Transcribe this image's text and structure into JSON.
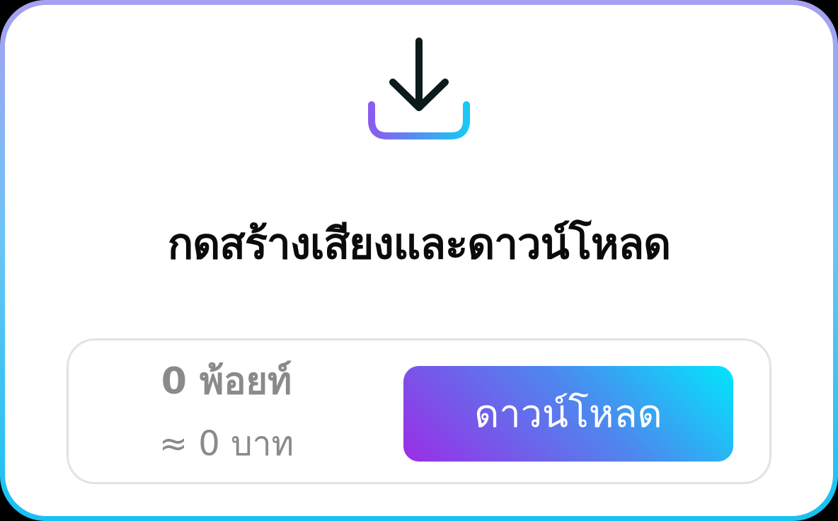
{
  "title": "กดสร้างเสียงและดาวน์โหลด",
  "price": {
    "points_label": "0 พ้อยท์",
    "baht_label": "≈ 0 บาท"
  },
  "download_button": {
    "label": "ดาวน์โหลด"
  },
  "icons": {
    "main": "download-icon"
  },
  "colors": {
    "title_text": "#0b0b0b",
    "muted_text": "#8a8a8a",
    "button_gradient_start": "#9a2ee6",
    "button_gradient_end": "#00e6fc",
    "icon_arrow": "#0b1a1a",
    "icon_tray_start": "#8a5cf0",
    "icon_tray_end": "#18c8f4"
  }
}
